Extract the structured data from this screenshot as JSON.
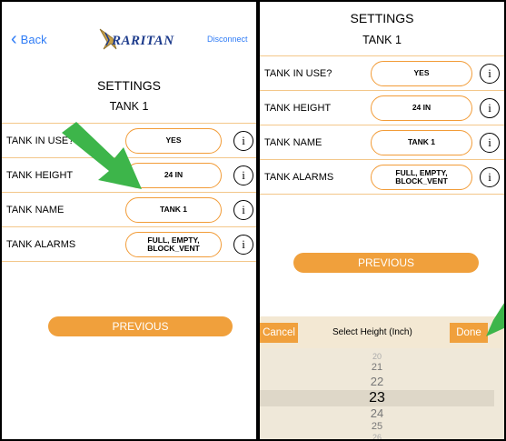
{
  "left": {
    "nav": {
      "back_label": "Back",
      "logo_text": "RARITAN",
      "disconnect_label": "Disconnect"
    },
    "title": "SETTINGS",
    "subtitle": "TANK 1",
    "rows": [
      {
        "label": "TANK IN USE?",
        "value": "YES"
      },
      {
        "label": "TANK HEIGHT",
        "value": "24 IN"
      },
      {
        "label": "TANK NAME",
        "value": "TANK 1"
      },
      {
        "label": "TANK ALARMS",
        "value_line1": "FULL, EMPTY,",
        "value_line2": "BLOCK_VENT"
      }
    ],
    "previous_label": "PREVIOUS"
  },
  "right": {
    "title": "SETTINGS",
    "subtitle": "TANK 1",
    "rows": [
      {
        "label": "TANK IN USE?",
        "value": "YES"
      },
      {
        "label": "TANK HEIGHT",
        "value": "24 IN"
      },
      {
        "label": "TANK NAME",
        "value": "TANK 1"
      },
      {
        "label": "TANK ALARMS",
        "value_line1": "FULL, EMPTY,",
        "value_line2": "BLOCK_VENT"
      }
    ],
    "previous_label": "PREVIOUS",
    "picker": {
      "cancel_label": "Cancel",
      "title": "Select Height (Inch)",
      "done_label": "Done",
      "options": [
        "20",
        "21",
        "22",
        "23",
        "24",
        "25",
        "26"
      ],
      "selected": "23"
    }
  },
  "icons": {
    "info": "info-circle-icon",
    "back": "chevron-left-icon",
    "arrow": "green-arrow-icon"
  },
  "colors": {
    "accent": "#f0a03c",
    "pill_border": "#f29c38",
    "row_border": "#f3c78a",
    "link": "#2f7cf6",
    "arrow": "#3db54a"
  }
}
